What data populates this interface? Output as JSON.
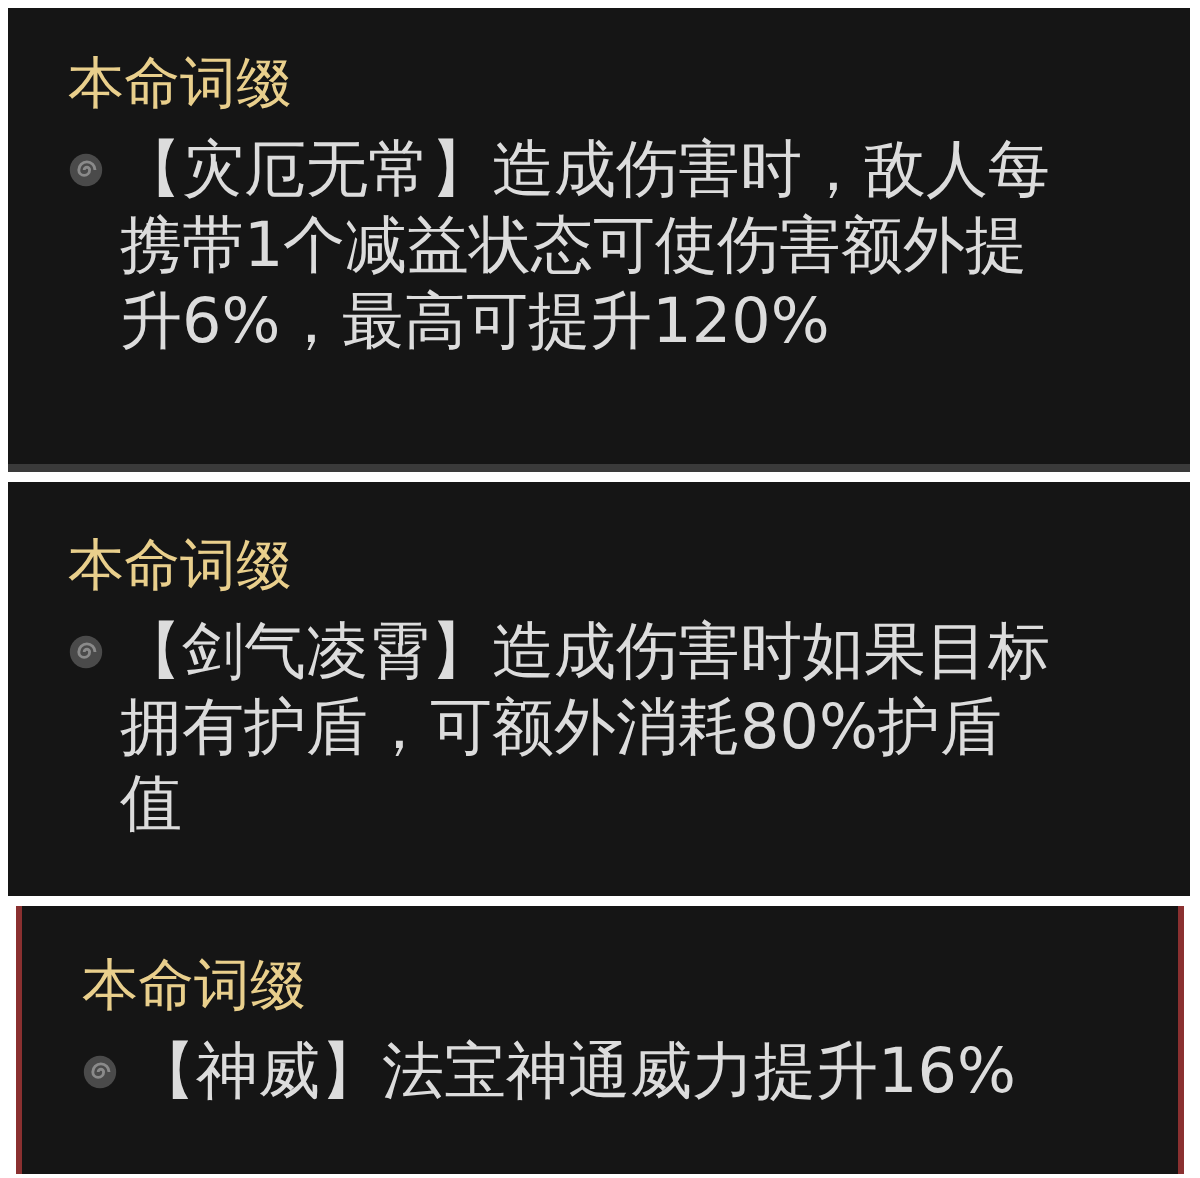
{
  "panels": [
    {
      "kind": "ruled",
      "title": "本命词缀",
      "affix": "【灾厄无常】造成伤害时，敌人每携带1个减益状态可使伤害额外提升6%，最高可提升120%"
    },
    {
      "kind": "plain",
      "title": "本命词缀",
      "affix": "【剑气凌霄】造成伤害时如果目标拥有护盾，可额外消耗80%护盾值"
    },
    {
      "kind": "red-edged",
      "title": "本命词缀",
      "affix": "【神威】法宝神通威力提升16%"
    }
  ]
}
